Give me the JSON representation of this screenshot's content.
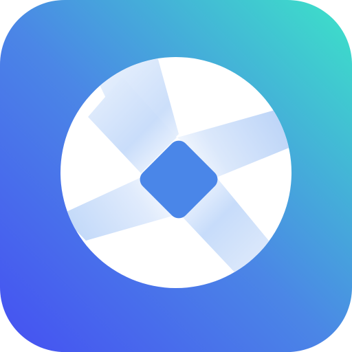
{
  "icon": {
    "semantic": "app-icon",
    "glyph": "disc-diamond-icon",
    "colors": {
      "gradient_start": "#4550f2",
      "gradient_mid": "#4b86e6",
      "gradient_end": "#3ce3c8",
      "disc": "#ffffff",
      "band": "#cfe2fb",
      "diamond": "#4a86e8"
    }
  }
}
